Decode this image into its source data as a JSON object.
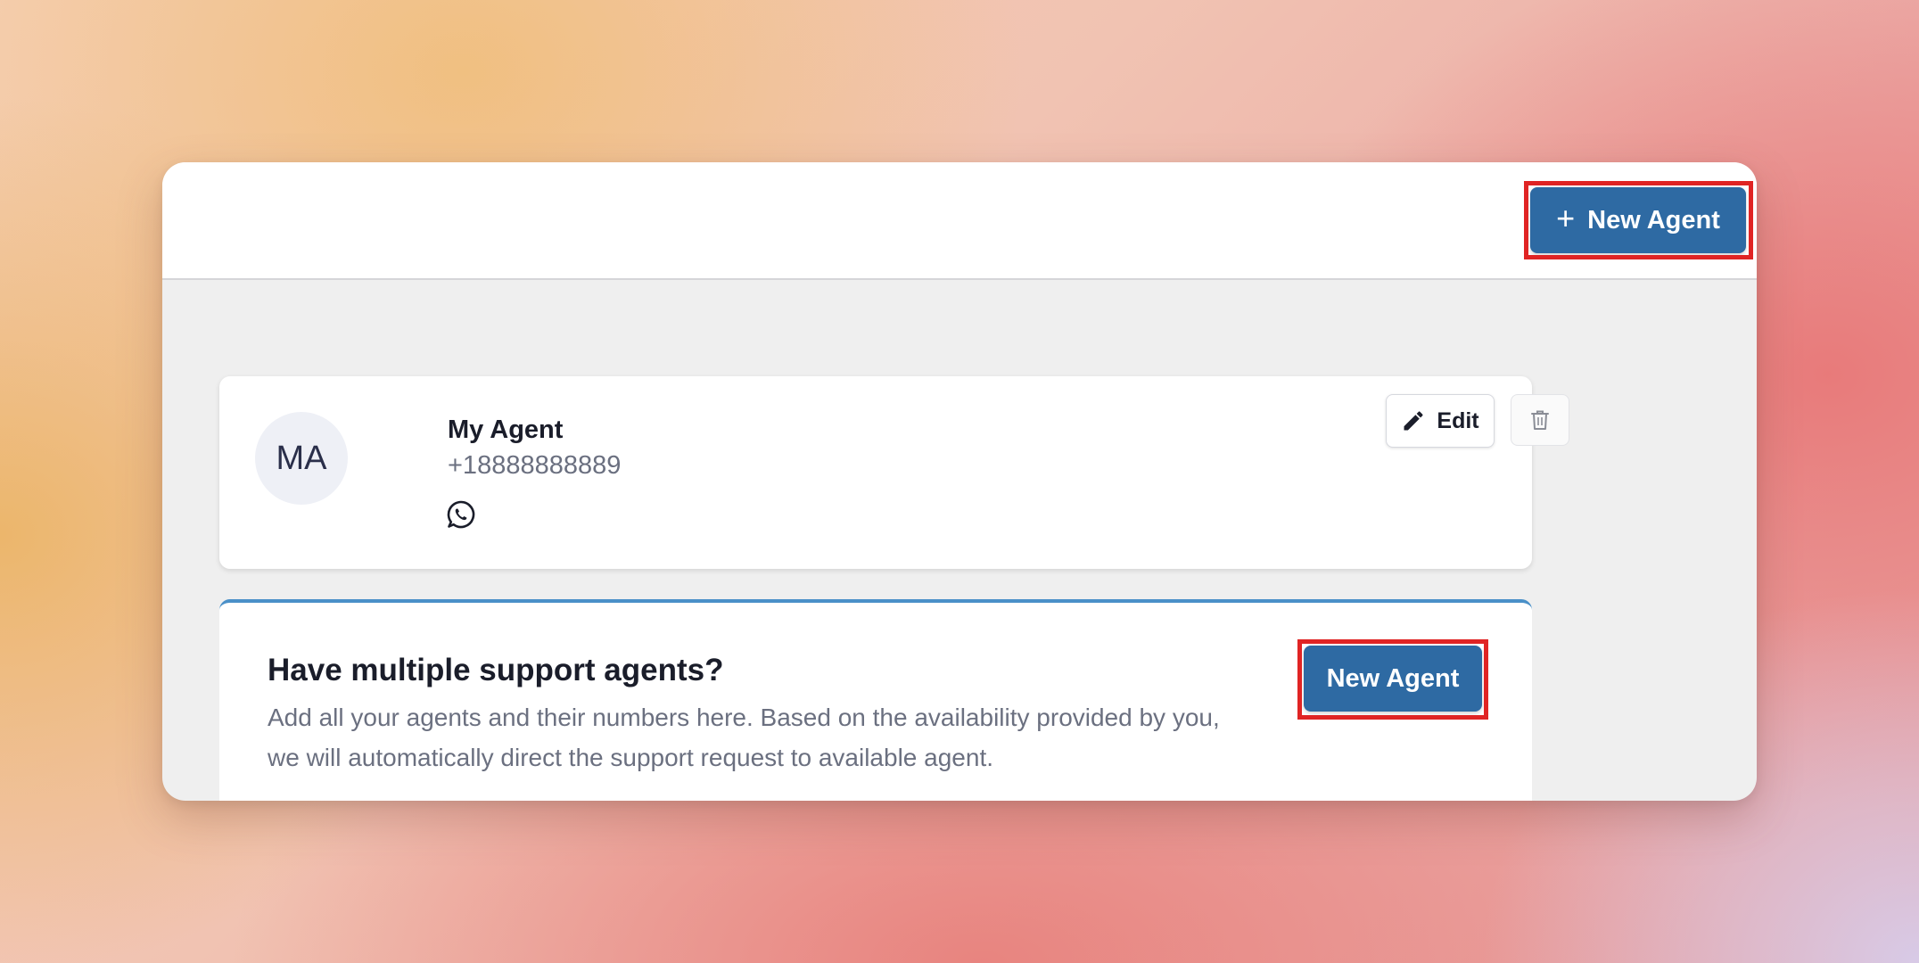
{
  "header": {
    "new_agent_label": "New Agent",
    "plus_icon": "plus-icon"
  },
  "agents": [
    {
      "initials": "MA",
      "name": "My Agent",
      "phone": "+18888888889",
      "channel_icon": "whatsapp-icon",
      "edit_label": "Edit",
      "delete_icon": "trash-icon"
    }
  ],
  "promo": {
    "title": "Have multiple support agents?",
    "description": "Add all your agents and their numbers here. Based on the availability provided by you, we will automatically direct the support request to available agent.",
    "button_label": "New Agent"
  },
  "colors": {
    "primary": "#2e6aa3",
    "highlight": "#e02424",
    "promo_accent": "#4a90c8"
  }
}
